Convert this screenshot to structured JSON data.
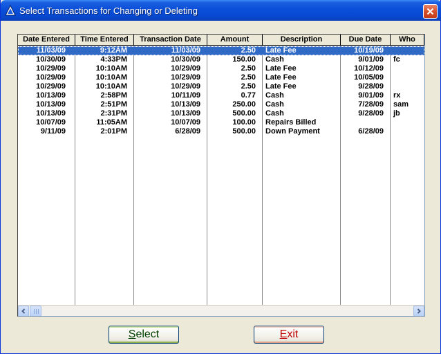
{
  "window": {
    "title": "Select Transactions for Changing or Deleting"
  },
  "columns": [
    "Date Entered",
    "Time Entered",
    "Transaction Date",
    "Amount",
    "Description",
    "Due Date",
    "Who"
  ],
  "rows": [
    {
      "date_entered": "11/03/09",
      "time_entered": "9:12AM",
      "transaction_date": "11/03/09",
      "amount": "2.50",
      "description": "Late Fee",
      "due_date": "10/19/09",
      "who": ""
    },
    {
      "date_entered": "10/30/09",
      "time_entered": "4:33PM",
      "transaction_date": "10/30/09",
      "amount": "150.00",
      "description": "Cash",
      "due_date": "9/01/09",
      "who": "fc"
    },
    {
      "date_entered": "10/29/09",
      "time_entered": "10:10AM",
      "transaction_date": "10/29/09",
      "amount": "2.50",
      "description": "Late Fee",
      "due_date": "10/12/09",
      "who": ""
    },
    {
      "date_entered": "10/29/09",
      "time_entered": "10:10AM",
      "transaction_date": "10/29/09",
      "amount": "2.50",
      "description": "Late Fee",
      "due_date": "10/05/09",
      "who": ""
    },
    {
      "date_entered": "10/29/09",
      "time_entered": "10:10AM",
      "transaction_date": "10/29/09",
      "amount": "2.50",
      "description": "Late Fee",
      "due_date": "9/28/09",
      "who": ""
    },
    {
      "date_entered": "10/13/09",
      "time_entered": "2:58PM",
      "transaction_date": "10/11/09",
      "amount": "0.77",
      "description": "Cash",
      "due_date": "9/01/09",
      "who": "rx"
    },
    {
      "date_entered": "10/13/09",
      "time_entered": "2:51PM",
      "transaction_date": "10/13/09",
      "amount": "250.00",
      "description": "Cash",
      "due_date": "7/28/09",
      "who": "sam"
    },
    {
      "date_entered": "10/13/09",
      "time_entered": "2:31PM",
      "transaction_date": "10/13/09",
      "amount": "500.00",
      "description": "Cash",
      "due_date": "9/28/09",
      "who": "jb"
    },
    {
      "date_entered": "10/07/09",
      "time_entered": "11:05AM",
      "transaction_date": "10/07/09",
      "amount": "100.00",
      "description": "Repairs Billed",
      "due_date": "",
      "who": ""
    },
    {
      "date_entered": "9/11/09",
      "time_entered": "2:01PM",
      "transaction_date": "6/28/09",
      "amount": "500.00",
      "description": "Down Payment",
      "due_date": "6/28/09",
      "who": ""
    }
  ],
  "selected_row": 0,
  "buttons": {
    "select": {
      "hotkey": "S",
      "rest": "elect"
    },
    "exit": {
      "hotkey": "E",
      "rest": "xit"
    }
  },
  "icons": {
    "app": "triangle-app-icon",
    "close": "close-icon",
    "scroll_left": "arrow-left-icon",
    "scroll_right": "arrow-right-icon"
  },
  "colors": {
    "titlebar": "#0a4fd8",
    "selection": "#316ac5",
    "select_text": "#004000",
    "exit_text": "#c00000"
  }
}
